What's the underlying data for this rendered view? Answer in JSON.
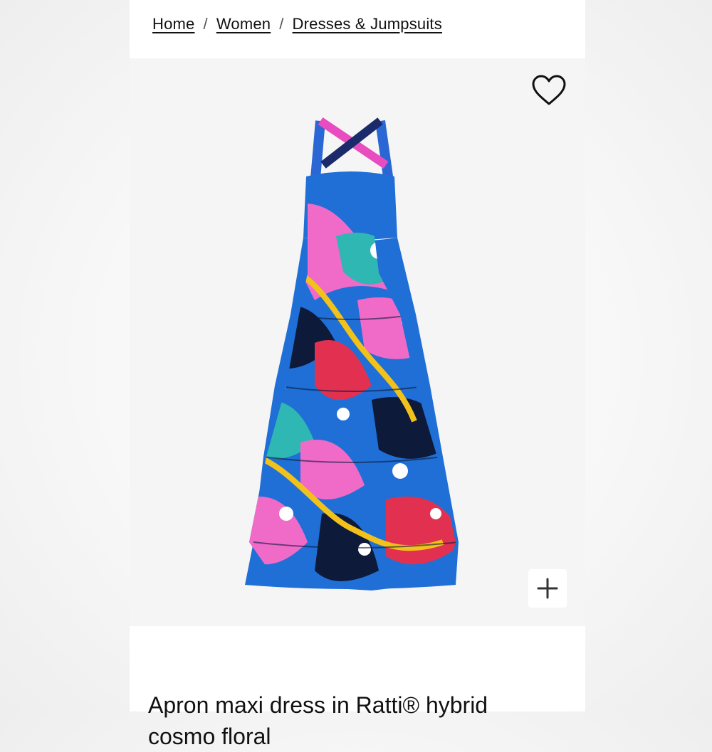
{
  "breadcrumb": {
    "items": [
      {
        "label": "Home"
      },
      {
        "label": "Women"
      },
      {
        "label": "Dresses & Jumpsuits"
      }
    ],
    "separator": "/"
  },
  "product": {
    "title": "Apron maxi dress in Ratti® hybrid cosmo floral",
    "image_alt": "Apron maxi dress in Ratti® hybrid cosmo floral"
  },
  "icons": {
    "wishlist": "heart-outline-icon",
    "zoom": "plus-icon"
  },
  "colors": {
    "text": "#111111",
    "panel": "#f5f5f5",
    "print_blue": "#1f6fd6",
    "print_pink": "#f06bc8",
    "print_navy": "#0e1a3a",
    "print_teal": "#2fb7b3",
    "print_red": "#e23150",
    "print_yellow": "#f2c21b"
  }
}
